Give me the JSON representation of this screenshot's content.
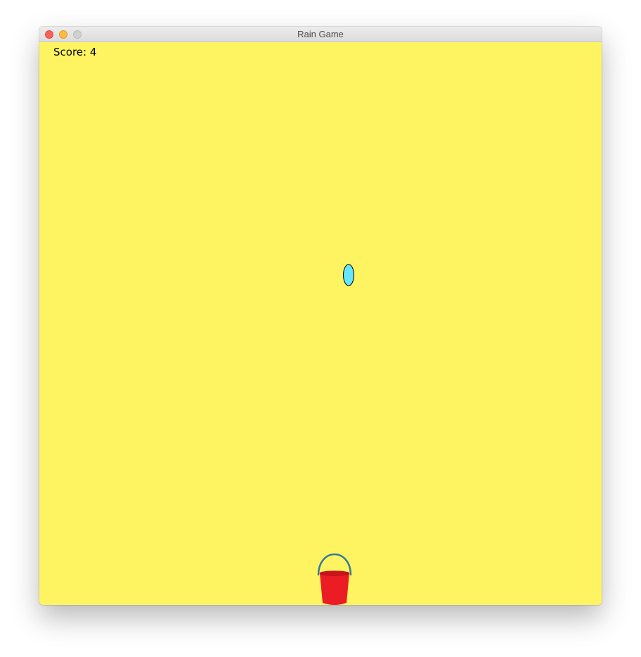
{
  "window": {
    "title": "Rain Game"
  },
  "hud": {
    "score_label": "Score: 4",
    "score": 4
  },
  "colors": {
    "background": "#fef462",
    "raindrop_fill": "#66e6fe",
    "raindrop_stroke": "#000000",
    "bucket_body": "#ec1c24",
    "bucket_rim": "#c9151b",
    "bucket_handle": "#3a7a96"
  },
  "sprites": {
    "raindrop": "raindrop-ellipse",
    "bucket": "red-bucket-with-handle"
  }
}
